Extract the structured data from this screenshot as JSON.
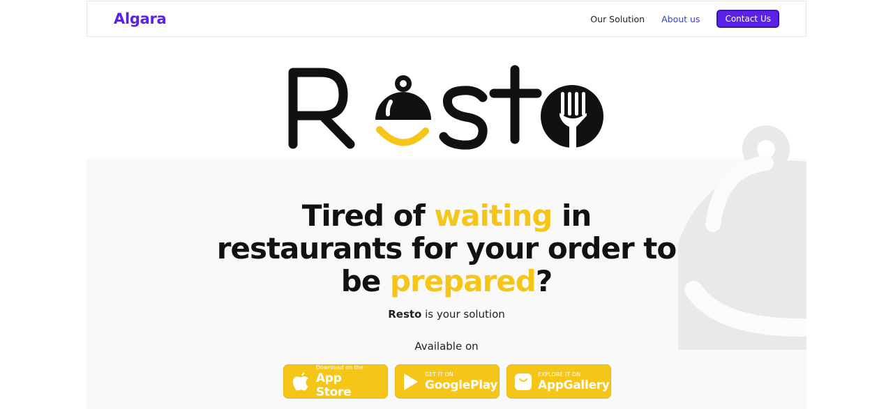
{
  "header": {
    "brand": "Algara",
    "nav": {
      "our_solution": "Our Solution",
      "about_us": "About us",
      "contact_us": "Contact Us"
    }
  },
  "logo": {
    "text": "Resto"
  },
  "hero": {
    "headline": {
      "part1": "Tired of ",
      "highlight1": "waiting",
      "part2": " in",
      "line2": "restaurants for your order to",
      "part3": "be ",
      "highlight2": "prepared",
      "part4": "?"
    },
    "tagline": {
      "bold": "Resto",
      "rest": " is your solution"
    },
    "available_on": "Available on"
  },
  "stores": [
    {
      "small": "Download on the",
      "big": "App Store",
      "icon": "apple-icon"
    },
    {
      "small": "GET IT ON",
      "big": "GooglePlay",
      "icon": "play-icon"
    },
    {
      "small": "EXPLORE IT ON",
      "big": "AppGallery",
      "icon": "huawei-icon"
    }
  ],
  "colors": {
    "brand": "#5b21e8",
    "accent_yellow": "#f5c518",
    "text": "#111111"
  }
}
